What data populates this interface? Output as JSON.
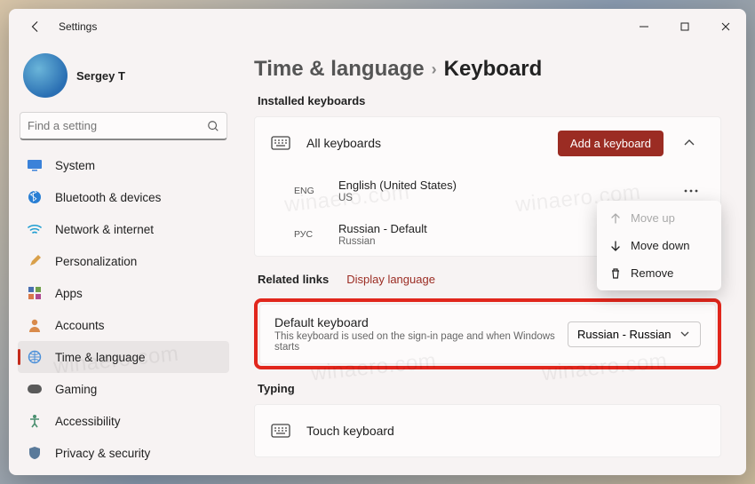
{
  "window": {
    "title": "Settings"
  },
  "user": {
    "name": "Sergey T"
  },
  "search": {
    "placeholder": "Find a setting"
  },
  "sidebar": {
    "items": [
      {
        "label": "System"
      },
      {
        "label": "Bluetooth & devices"
      },
      {
        "label": "Network & internet"
      },
      {
        "label": "Personalization"
      },
      {
        "label": "Apps"
      },
      {
        "label": "Accounts"
      },
      {
        "label": "Time & language"
      },
      {
        "label": "Gaming"
      },
      {
        "label": "Accessibility"
      },
      {
        "label": "Privacy & security"
      }
    ]
  },
  "breadcrumb": {
    "parent": "Time & language",
    "current": "Keyboard"
  },
  "sections": {
    "installed_label": "Installed keyboards",
    "all_keyboards": "All keyboards",
    "add_button": "Add a keyboard",
    "keyboards": [
      {
        "tag": "ENG",
        "title": "English (United States)",
        "sub": "US"
      },
      {
        "tag": "РУС",
        "title": "Russian  - Default",
        "sub": "Russian"
      }
    ],
    "related_label": "Related links",
    "related_link": "Display language",
    "default": {
      "title": "Default keyboard",
      "desc": "This keyboard is used on the sign-in page and when Windows starts",
      "value": "Russian - Russian"
    },
    "typing_label": "Typing",
    "touch_keyboard": "Touch keyboard"
  },
  "context_menu": {
    "move_up": "Move up",
    "move_down": "Move down",
    "remove": "Remove"
  },
  "watermark": "winaero.com"
}
